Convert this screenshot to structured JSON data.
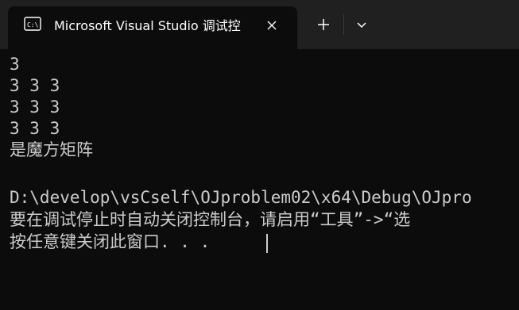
{
  "window": {
    "tab_title": "Microsoft Visual Studio 调试控",
    "tab_icon": "console-icon",
    "close_icon": "close-icon",
    "new_tab_icon": "plus-icon",
    "dropdown_icon": "chevron-down-icon"
  },
  "console": {
    "lines": [
      "3",
      "3 3 3",
      "3 3 3",
      "3 3 3",
      "是魔方矩阵",
      "",
      "D:\\develop\\vsCself\\OJproblem02\\x64\\Debug\\OJpro",
      "要在调试停止时自动关闭控制台，请启用“工具”->“选",
      "按任意键关闭此窗口. . ."
    ]
  },
  "colors": {
    "background": "#0c0c0c",
    "titlebar": "#202020",
    "text": "#cccccc"
  }
}
